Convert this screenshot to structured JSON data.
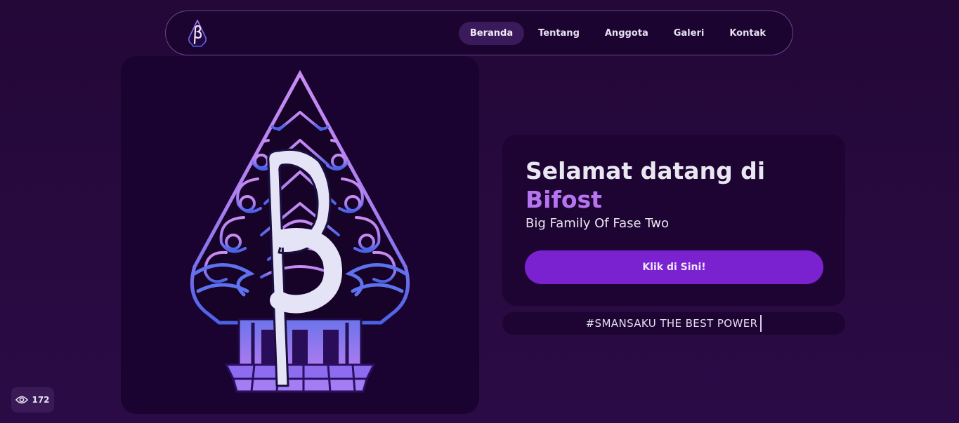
{
  "nav": {
    "logo_icon": "bifost-logo-icon",
    "links": [
      {
        "label": "Beranda",
        "active": true
      },
      {
        "label": "Tentang",
        "active": false
      },
      {
        "label": "Anggota",
        "active": false
      },
      {
        "label": "Galeri",
        "active": false
      },
      {
        "label": "Kontak",
        "active": false
      }
    ]
  },
  "hero": {
    "image_icon": "gunungan-beta-logo"
  },
  "welcome": {
    "heading": "Selamat datang di",
    "brand": "Bifost",
    "subtitle": "Big Family Of Fase Two",
    "cta_label": "Klik di Sini!"
  },
  "tagline": {
    "text": "#SMANSAKU THE BEST POWER"
  },
  "views": {
    "icon": "eye-icon",
    "count": "172"
  },
  "colors": {
    "background": "#2a0a42",
    "card": "#1d0433",
    "accent": "#7a22cf",
    "brand_text": "#b774f0"
  }
}
